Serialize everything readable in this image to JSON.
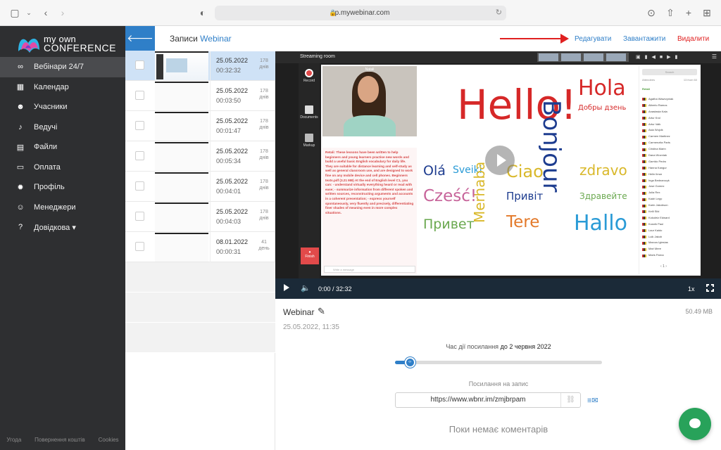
{
  "browser": {
    "url": "cp.mywebinar.com"
  },
  "sidebar": {
    "logo_line1": "my own",
    "logo_line2": "CONFERENCE",
    "items": [
      {
        "label": "Вебінари 24/7",
        "icon": "infinity-icon",
        "glyph": "∞",
        "active": true
      },
      {
        "label": "Календар",
        "icon": "calendar-icon",
        "glyph": "▦"
      },
      {
        "label": "Учасники",
        "icon": "users-icon",
        "glyph": "☻"
      },
      {
        "label": "Ведучі",
        "icon": "microphone-icon",
        "glyph": "♪"
      },
      {
        "label": "Файли",
        "icon": "files-icon",
        "glyph": "▤"
      },
      {
        "label": "Оплата",
        "icon": "card-icon",
        "glyph": "▭"
      },
      {
        "label": "Профіль",
        "icon": "gear-icon",
        "glyph": "✹"
      },
      {
        "label": "Менеджери",
        "icon": "managers-icon",
        "glyph": "☺"
      },
      {
        "label": "Довідкова ▾",
        "icon": "help-icon",
        "glyph": "?"
      }
    ],
    "footer": [
      "Угода",
      "Повернення коштів",
      "Cookies"
    ]
  },
  "header": {
    "title": "Записи",
    "title_accent": "Webinar",
    "edit": "Редагувати",
    "download": "Завантажити",
    "delete": "Видалити"
  },
  "records": [
    {
      "date": "25.05.2022",
      "duration": "00:32:32",
      "days": "178",
      "days_unit": "днів",
      "selected": true,
      "thumb": "video"
    },
    {
      "date": "25.05.2022",
      "duration": "00:03:50",
      "days": "178",
      "days_unit": "днів"
    },
    {
      "date": "25.05.2022",
      "duration": "00:01:47",
      "days": "178",
      "days_unit": "днів"
    },
    {
      "date": "25.05.2022",
      "duration": "00:05:34",
      "days": "178",
      "days_unit": "днів"
    },
    {
      "date": "25.05.2022",
      "duration": "00:04:01",
      "days": "178",
      "days_unit": "днів"
    },
    {
      "date": "25.05.2022",
      "duration": "00:04:03",
      "days": "178",
      "days_unit": "днів"
    },
    {
      "date": "08.01.2022",
      "duration": "00:00:31",
      "days": "41",
      "days_unit": "день"
    }
  ],
  "video": {
    "room_title": "Streaming room",
    "presenter_name": "Natali",
    "tools": [
      "Record",
      "Documents",
      "Markup"
    ],
    "finish": "Finish",
    "chat_text": "Retali: These lessons have been written to help beginners and young learners practise new words and build a useful basic English vocabulary for daily life. They are suitable for distance learning and self-study as well as general classroom use, and are designed to work fine on any mobile device and cell phones. Beginners texts.pdf (3.21 MB) At the end of English level C1, you can: - understand virtually everything heard or read with ease; - summarize information from different spoken and written sources, reconstructing arguments and accounts in a coherent presentation; - express yourself spontaneously, very fluently and precisely, differentiating finer shades of meaning even in more complex situations.",
    "chat_placeholder": "Write a message",
    "words": [
      "Hello!",
      "Bonjour",
      "Hola",
      "Добры дзень",
      "Olá",
      "Sveiki",
      "Merhaba",
      "Ciao",
      "zdravo",
      "Cześć!",
      "Привіт",
      "Здравейте",
      "Привет",
      "Tere",
      "Hallo"
    ],
    "participants_search": "Search",
    "participants_header": "Attendees",
    "participants_count": "13 from 60",
    "host": "Retali",
    "participants": [
      "Agatha Wawrzyniak",
      "Alberto Ramos",
      "Anastasia Kala",
      "Artur Krol",
      "Artur Valk",
      "Asia Wojcik",
      "Carmen Martinez",
      "Carmenzita Parts",
      "Cristina Marin",
      "Dana Wozniak",
      "Garrido Pedro",
      "Hanna Kangur",
      "Helin Ilmar",
      "Inga Bednarczyk",
      "Jose Gomez",
      "Julia Rex",
      "Kadri Lepp",
      "Karin Jakobson",
      "Kelli Sild",
      "Kokoleiz Edward",
      "Kusnik Paul",
      "Laur Kaido",
      "Luik Jakob",
      "Marcos Iglesias",
      "Mari Mere",
      "Maris Parna"
    ],
    "page": "1"
  },
  "player": {
    "time": "0:00 / 32:32",
    "speed": "1x",
    "progress": 0
  },
  "details": {
    "title": "Webinar",
    "size": "50.49 MB",
    "date": "25.05.2022, 11:35",
    "expiry_label": "Час дії посилання",
    "expiry_value": "до 2 червня 2022",
    "link_label": "Посилання на запис",
    "link": "https://www.wbnr.im/zmjbrpam",
    "no_comments": "Поки немає коментарів",
    "slider_fraction": 0.07
  },
  "colors": {
    "accent": "#2f7fc8",
    "delete": "#e02020",
    "sidebar_bg": "#2e2f31",
    "fab": "#28a25a"
  }
}
